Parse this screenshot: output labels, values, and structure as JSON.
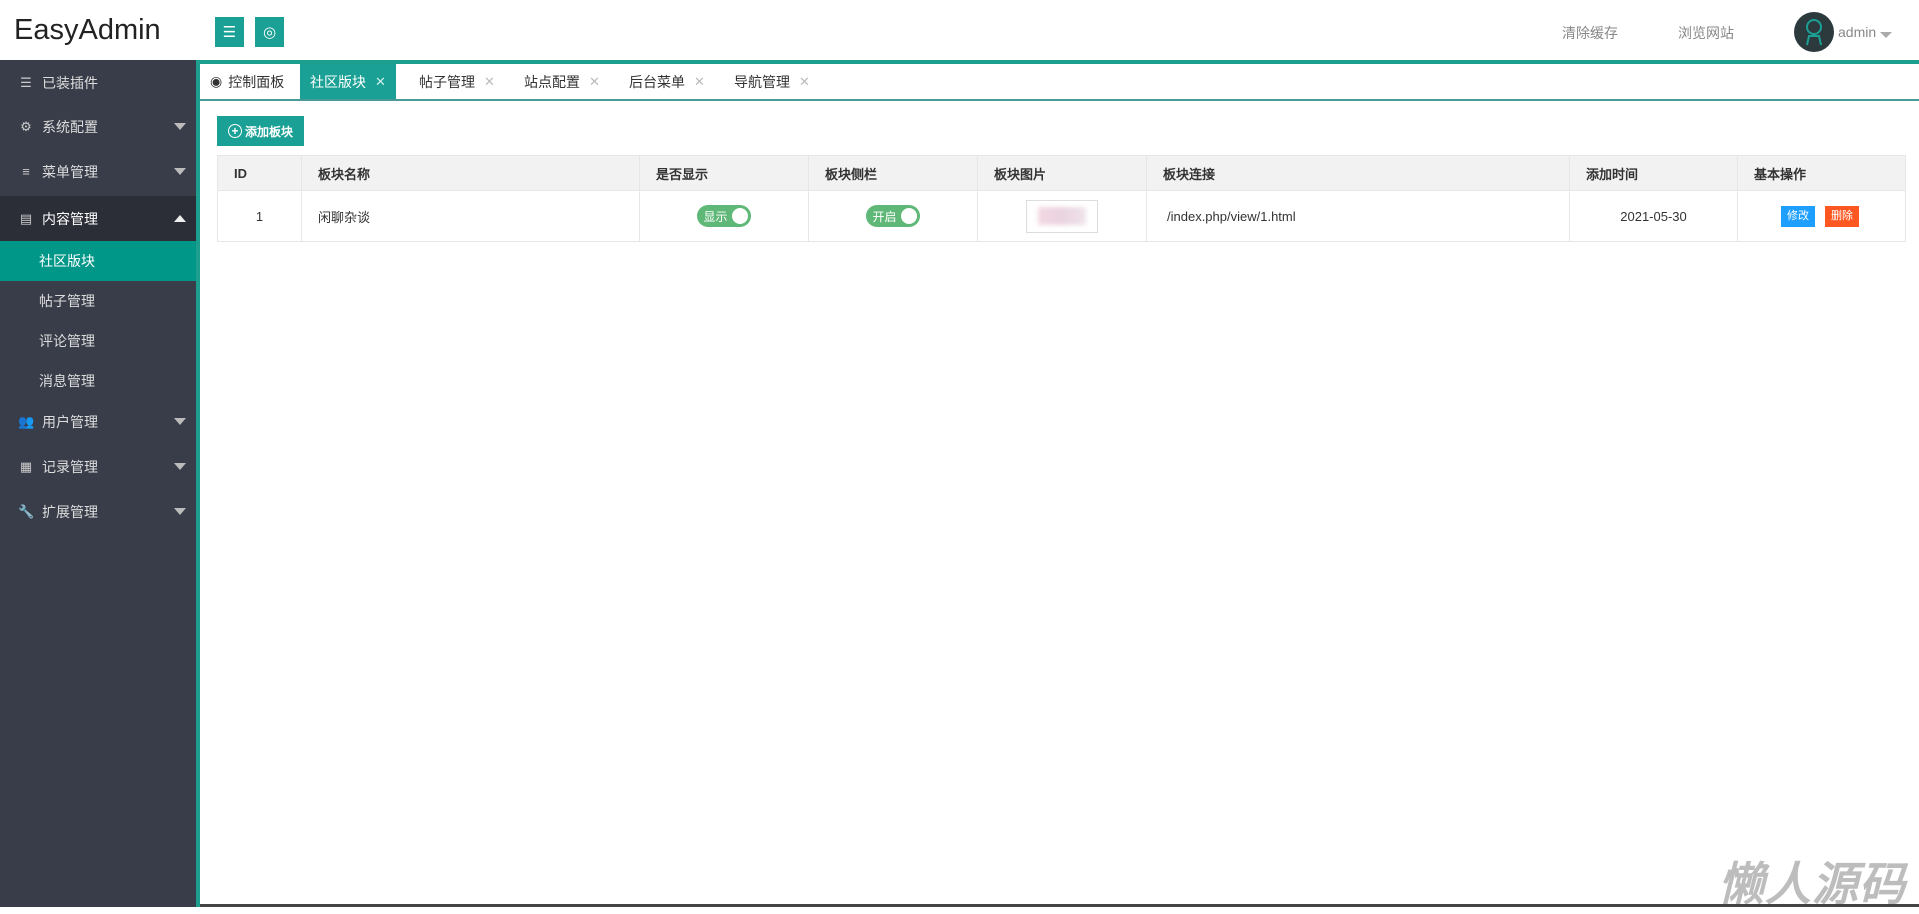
{
  "header": {
    "logo": "EasyAdmin",
    "clear_cache": "清除缓存",
    "browse_site": "浏览网站",
    "username": "admin",
    "menu_icon": "hamburger-icon",
    "globe_icon": "globe-icon"
  },
  "sidebar": {
    "items": [
      {
        "label": "已装插件",
        "icon": "sliders-icon"
      },
      {
        "label": "系统配置",
        "icon": "gears-icon"
      },
      {
        "label": "菜单管理",
        "icon": "list-icon"
      },
      {
        "label": "内容管理",
        "icon": "file-icon"
      },
      {
        "label": "用户管理",
        "icon": "users-icon"
      },
      {
        "label": "记录管理",
        "icon": "grid-icon"
      },
      {
        "label": "扩展管理",
        "icon": "wrench-icon"
      }
    ],
    "submenu": [
      "社区版块",
      "帖子管理",
      "评论管理",
      "消息管理"
    ]
  },
  "tabs": [
    {
      "label": "控制面板"
    },
    {
      "label": "社区版块",
      "close": "✕"
    },
    {
      "label": "帖子管理",
      "close": "✕"
    },
    {
      "label": "站点配置",
      "close": "✕"
    },
    {
      "label": "后台菜单",
      "close": "✕"
    },
    {
      "label": "导航管理",
      "close": "✕"
    }
  ],
  "toolbar": {
    "add_label": "添加板块"
  },
  "table": {
    "headers": [
      "ID",
      "板块名称",
      "是否显示",
      "板块侧栏",
      "板块图片",
      "板块连接",
      "添加时间",
      "基本操作"
    ],
    "rows": [
      {
        "id": "1",
        "name": "闲聊杂谈",
        "show": "显示",
        "sidebar": "开启",
        "link": "/index.php/view/1.html",
        "date": "2021-05-30",
        "edit": "修改",
        "delete": "删除"
      }
    ]
  },
  "colors": {
    "accent": "#1aa094",
    "sidebar_bg": "#393d49",
    "switch_on": "#5fb878",
    "edit": "#1e9fff",
    "delete": "#ff5722"
  },
  "watermark": "懒人源码"
}
